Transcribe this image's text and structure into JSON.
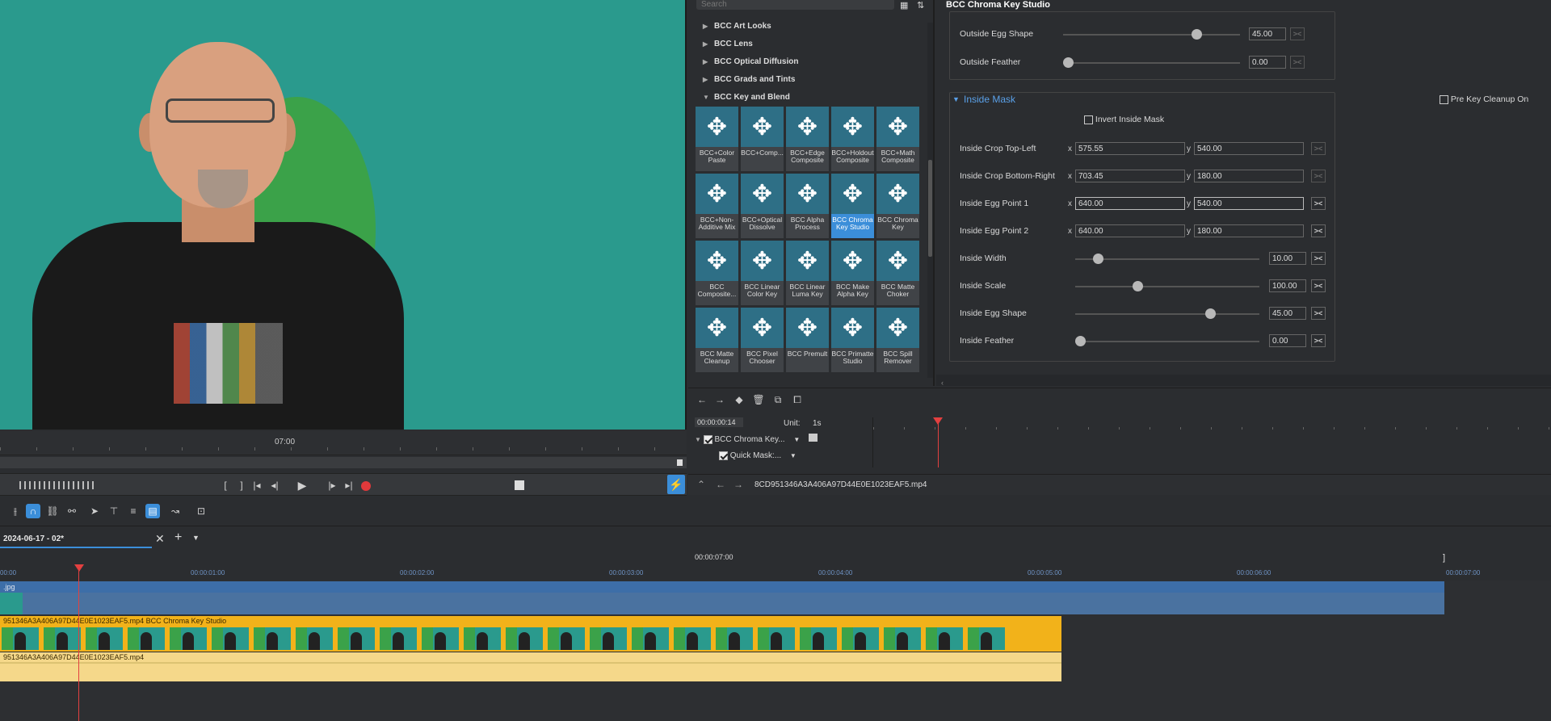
{
  "preview": {
    "timecode_label": "07:00"
  },
  "library": {
    "search_placeholder": "Search",
    "categories": [
      "BCC Art Looks",
      "BCC Lens",
      "BCC Optical Diffusion",
      "BCC Grads and Tints",
      "BCC Key and Blend"
    ],
    "effects": [
      "BCC+Color Paste",
      "BCC+Comp...",
      "BCC+Edge Composite",
      "BCC+Holdout Composite",
      "BCC+Math Composite",
      "BCC+Non-Additive Mix",
      "BCC+Optical Dissolve",
      "BCC Alpha Process",
      "BCC Chroma Key Studio",
      "BCC Chroma Key",
      "BCC Composite...",
      "BCC Linear Color Key",
      "BCC Linear Luma Key",
      "BCC Make Alpha Key",
      "BCC Matte Choker",
      "BCC Matte Cleanup",
      "BCC Pixel Chooser",
      "BCC Premult",
      "BCC Primatte Studio",
      "BCC Spill Remover"
    ],
    "selected_effect": "BCC Chroma Key Studio"
  },
  "inspector": {
    "title": "BCC Chroma Key Studio",
    "outside": {
      "egg_shape_label": "Outside Egg Shape",
      "egg_shape_value": "45.00",
      "egg_shape_level": 0.77,
      "feather_label": "Outside Feather",
      "feather_value": "0.00",
      "feather_level": 0.0
    },
    "inside_mask_title": "Inside Mask",
    "pre_key_cleanup": "Pre Key Cleanup On",
    "invert_inside_mask": "Invert Inside Mask",
    "crop_tl_label": "Inside Crop Top-Left",
    "crop_tl_x": "575.55",
    "crop_tl_y": "540.00",
    "crop_br_label": "Inside Crop Bottom-Right",
    "crop_br_x": "703.45",
    "crop_br_y": "180.00",
    "egg1_label": "Inside Egg Point 1",
    "egg1_x": "640.00",
    "egg1_y": "540.00",
    "egg2_label": "Inside Egg Point 2",
    "egg2_x": "640.00",
    "egg2_y": "180.00",
    "width_label": "Inside Width",
    "width_value": "10.00",
    "width_level": 0.1,
    "scale_label": "Inside Scale",
    "scale_value": "100.00",
    "scale_level": 0.33,
    "egg_shape_label": "Inside Egg Shape",
    "egg_shape_value": "45.00",
    "egg_shape_level": 0.75,
    "feather_label": "Inside Feather",
    "feather_value": "0.00",
    "feather_level": 0.0,
    "x": "x",
    "y": "y"
  },
  "keyframes": {
    "timecode": "00:00:00:14",
    "unit_label": "Unit:",
    "unit_value": "1s",
    "track1": "BCC Chroma Key...",
    "track2": "Quick Mask:...",
    "file": "8CD951346A3A406A97D44E0E1023EAF5.mp4"
  },
  "timeline": {
    "tab": "2024-06-17 - 02*",
    "center_time": "00:00:07:00",
    "marks": [
      "00:00",
      "00:00:01:00",
      "00:00:02:00",
      "00:00:03:00",
      "00:00:04:00",
      "00:00:05:00",
      "00:00:06:00",
      "00:00:07:00"
    ],
    "jpg_track": ".jpg",
    "video_track": "951346A3A406A97D44E0E1023EAF5.mp4  BCC Chroma Key Studio",
    "audio_track": "951346A3A406A97D44E0E1023EAF5.mp4"
  }
}
